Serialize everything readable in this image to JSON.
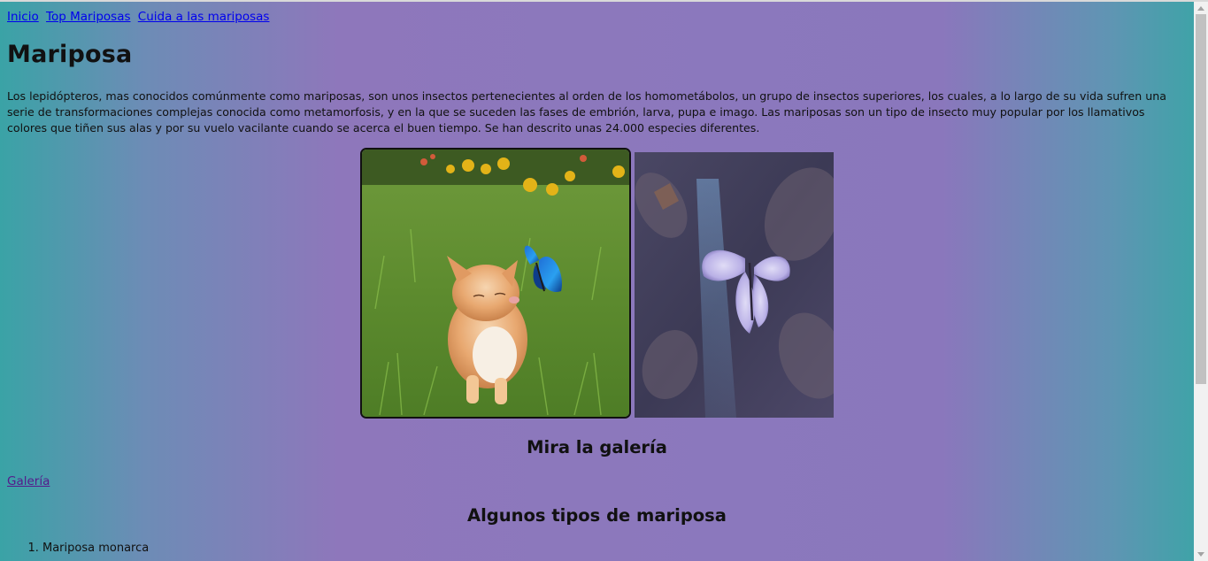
{
  "nav": {
    "links": [
      "Inicio",
      "Top Mariposas",
      "Cuida a las mariposas"
    ]
  },
  "page_title": "Mariposa",
  "intro_text": "Los lepidópteros, mas conocidos comúnmente como mariposas, son unos insectos pertenecientes al orden de los homometábolos, un grupo de insectos superiores, los cuales, a lo largo de su vida sufren una serie de transformaciones complejas conocida como metamorfosis, y en la que se suceden las fases de embrión, larva, pupa e imago. Las mariposas son un tipo de insecto muy popular por los llamativos colores que tiñen sus alas y por su vuelo vacilante cuando se acerca el buen tiempo. Se han descrito unas 24.000 especies diferentes.",
  "gallery_heading": "Mira la galería",
  "gallery_link": "Galería",
  "types_heading": "Algunos tipos de mariposa",
  "types_list": [
    "Mariposa monarca"
  ],
  "colors": {
    "link": "#0000ee",
    "visited_link": "#551a8b",
    "background_purple": "#8b78bd",
    "background_teal": "#3aa3a6"
  }
}
